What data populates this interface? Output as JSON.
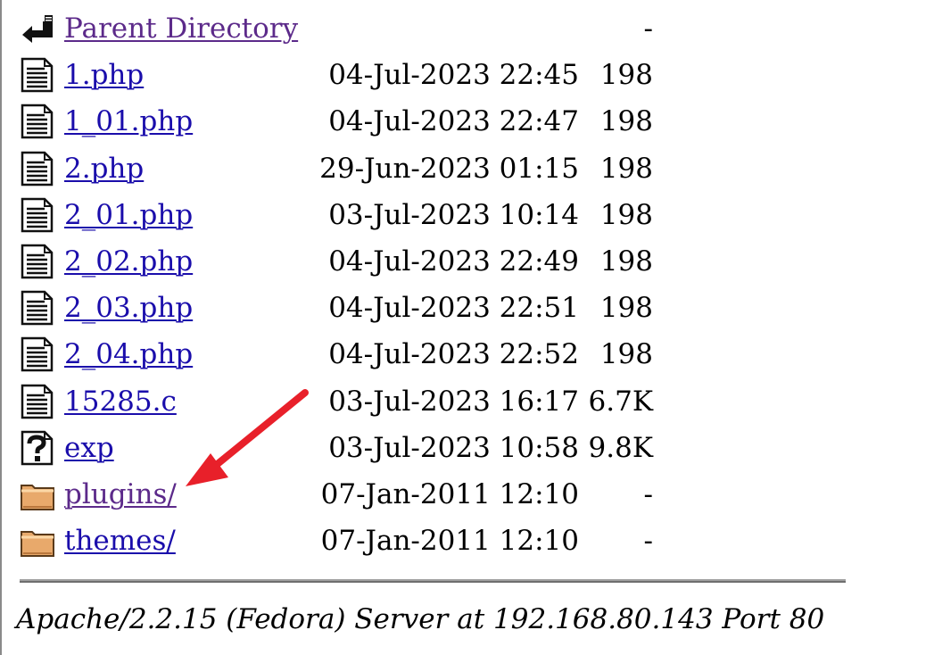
{
  "listing": {
    "parent": {
      "name": "Parent Directory",
      "date": "",
      "size": "-",
      "icon": "back-arrow-icon"
    },
    "entries": [
      {
        "name": "1.php",
        "date": "04-Jul-2023 22:45",
        "size": "198",
        "icon": "text-file-icon"
      },
      {
        "name": "1_01.php",
        "date": "04-Jul-2023 22:47",
        "size": "198",
        "icon": "text-file-icon"
      },
      {
        "name": "2.php",
        "date": "29-Jun-2023 01:15",
        "size": "198",
        "icon": "text-file-icon"
      },
      {
        "name": "2_01.php",
        "date": "03-Jul-2023 10:14",
        "size": "198",
        "icon": "text-file-icon"
      },
      {
        "name": "2_02.php",
        "date": "04-Jul-2023 22:49",
        "size": "198",
        "icon": "text-file-icon"
      },
      {
        "name": "2_03.php",
        "date": "04-Jul-2023 22:51",
        "size": "198",
        "icon": "text-file-icon"
      },
      {
        "name": "2_04.php",
        "date": "04-Jul-2023 22:52",
        "size": "198",
        "icon": "text-file-icon"
      },
      {
        "name": "15285.c",
        "date": "03-Jul-2023 16:17",
        "size": "6.7K",
        "icon": "text-file-icon"
      },
      {
        "name": "exp",
        "date": "03-Jul-2023 10:58",
        "size": "9.8K",
        "icon": "unknown-file-icon"
      },
      {
        "name": "plugins/",
        "date": "07-Jan-2011 12:10",
        "size": "-",
        "icon": "folder-icon"
      },
      {
        "name": "themes/",
        "date": "07-Jan-2011 12:10",
        "size": "-",
        "icon": "folder-icon"
      }
    ]
  },
  "footer": {
    "address": "Apache/2.2.15 (Fedora) Server at 192.168.80.143 Port 80"
  },
  "colors": {
    "link": "#1a0dab",
    "visited_link": "#5c2a8a",
    "annotation_arrow": "#e8202a"
  }
}
